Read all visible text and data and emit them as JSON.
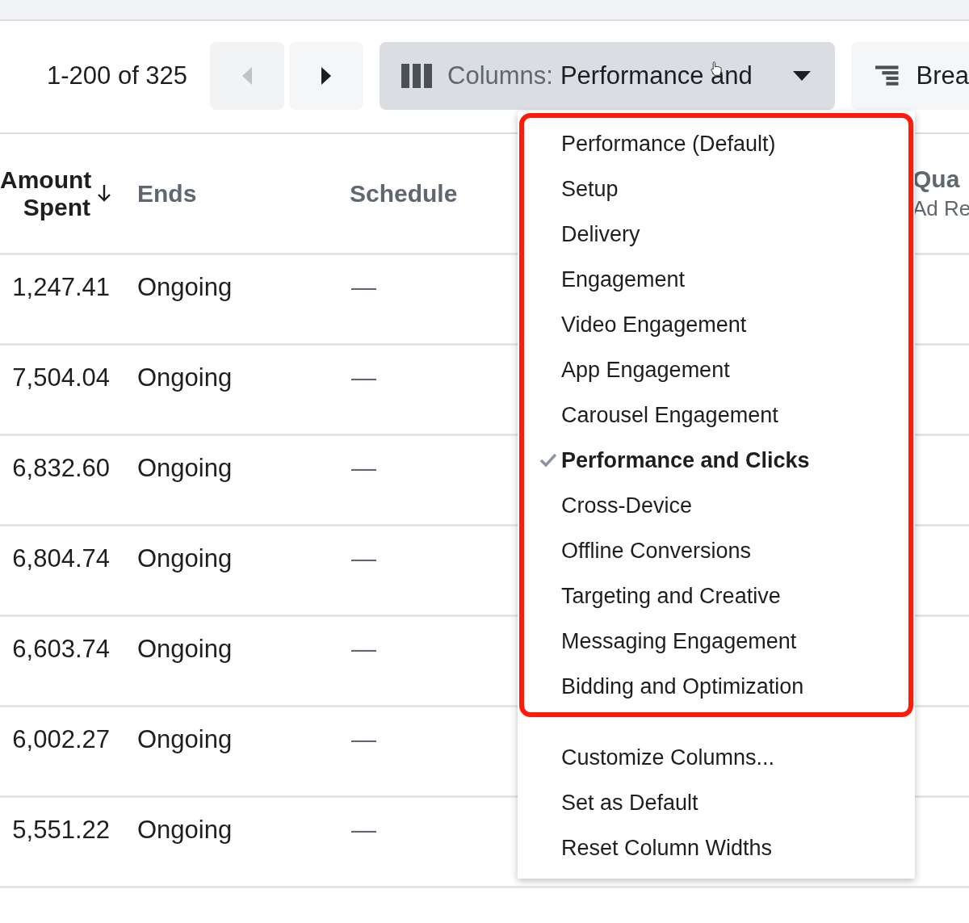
{
  "pager": {
    "range": "1-200 of 325",
    "prev": {
      "disabled": true
    },
    "next": {
      "disabled": false
    }
  },
  "columns_button": {
    "label": "Columns:",
    "value": "Performance and"
  },
  "breakdown_button": {
    "label": "Brea"
  },
  "table": {
    "columns": [
      {
        "label": "Amount Spent",
        "sorted": true
      },
      {
        "label": "Ends",
        "sorted": false
      },
      {
        "label": "Schedule",
        "sorted": false
      },
      {
        "label": "Qua",
        "sublabel": "Ad Re",
        "sorted": false
      }
    ],
    "rows": [
      {
        "amount": "1,247.41",
        "ends": "Ongoing",
        "schedule": "—"
      },
      {
        "amount": "7,504.04",
        "ends": "Ongoing",
        "schedule": "—"
      },
      {
        "amount": "6,832.60",
        "ends": "Ongoing",
        "schedule": "—"
      },
      {
        "amount": "6,804.74",
        "ends": "Ongoing",
        "schedule": "—"
      },
      {
        "amount": "6,603.74",
        "ends": "Ongoing",
        "schedule": "—"
      },
      {
        "amount": "6,002.27",
        "ends": "Ongoing",
        "schedule": "—"
      },
      {
        "amount": "5,551.22",
        "ends": "Ongoing",
        "schedule": "—"
      }
    ]
  },
  "columns_menu": {
    "presets": [
      {
        "label": "Performance (Default)",
        "selected": false
      },
      {
        "label": "Setup",
        "selected": false
      },
      {
        "label": "Delivery",
        "selected": false
      },
      {
        "label": "Engagement",
        "selected": false
      },
      {
        "label": "Video Engagement",
        "selected": false
      },
      {
        "label": "App Engagement",
        "selected": false
      },
      {
        "label": "Carousel Engagement",
        "selected": false
      },
      {
        "label": "Performance and Clicks",
        "selected": true
      },
      {
        "label": "Cross-Device",
        "selected": false
      },
      {
        "label": "Offline Conversions",
        "selected": false
      },
      {
        "label": "Targeting and Creative",
        "selected": false
      },
      {
        "label": "Messaging Engagement",
        "selected": false
      },
      {
        "label": "Bidding and Optimization",
        "selected": false
      }
    ],
    "actions": [
      "Customize Columns...",
      "Set as Default",
      "Reset Column Widths"
    ]
  }
}
